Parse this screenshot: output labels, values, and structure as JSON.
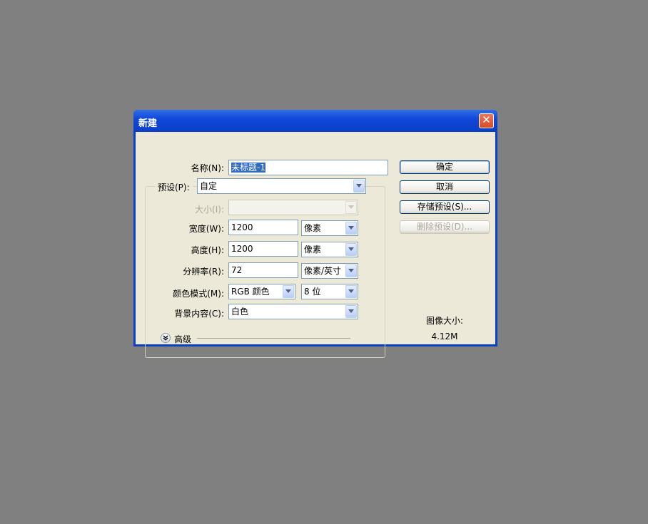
{
  "dialog": {
    "title": "新建",
    "close_glyph": "✕"
  },
  "form": {
    "name_label": "名称(N):",
    "name_value": "未标题-1",
    "preset_label": "预设(P):",
    "preset_value": "自定",
    "size_label": "大小(I):",
    "size_value": "",
    "width_label": "宽度(W):",
    "width_value": "1200",
    "width_unit": "像素",
    "height_label": "高度(H):",
    "height_value": "1200",
    "height_unit": "像素",
    "resolution_label": "分辨率(R):",
    "resolution_value": "72",
    "resolution_unit": "像素/英寸",
    "color_mode_label": "颜色模式(M):",
    "color_mode_value": "RGB 颜色",
    "bit_depth_value": "8 位",
    "background_label": "背景内容(C):",
    "background_value": "白色",
    "advanced_label": "高级"
  },
  "buttons": {
    "ok": "确定",
    "cancel": "取消",
    "save_preset": "存储预设(S)...",
    "delete_preset": "删除预设(D)..."
  },
  "info": {
    "image_size_label": "图像大小:",
    "image_size_value": "4.12M"
  },
  "icons": {
    "close": "close-icon",
    "dropdown": "chevron-down-icon",
    "expand": "double-chevron-down-icon"
  },
  "colors": {
    "titlebar": "#0a3fc8",
    "close_button": "#d94a24",
    "client": "#ece9d8",
    "selection": "#316ac5",
    "desktop": "#808080"
  }
}
